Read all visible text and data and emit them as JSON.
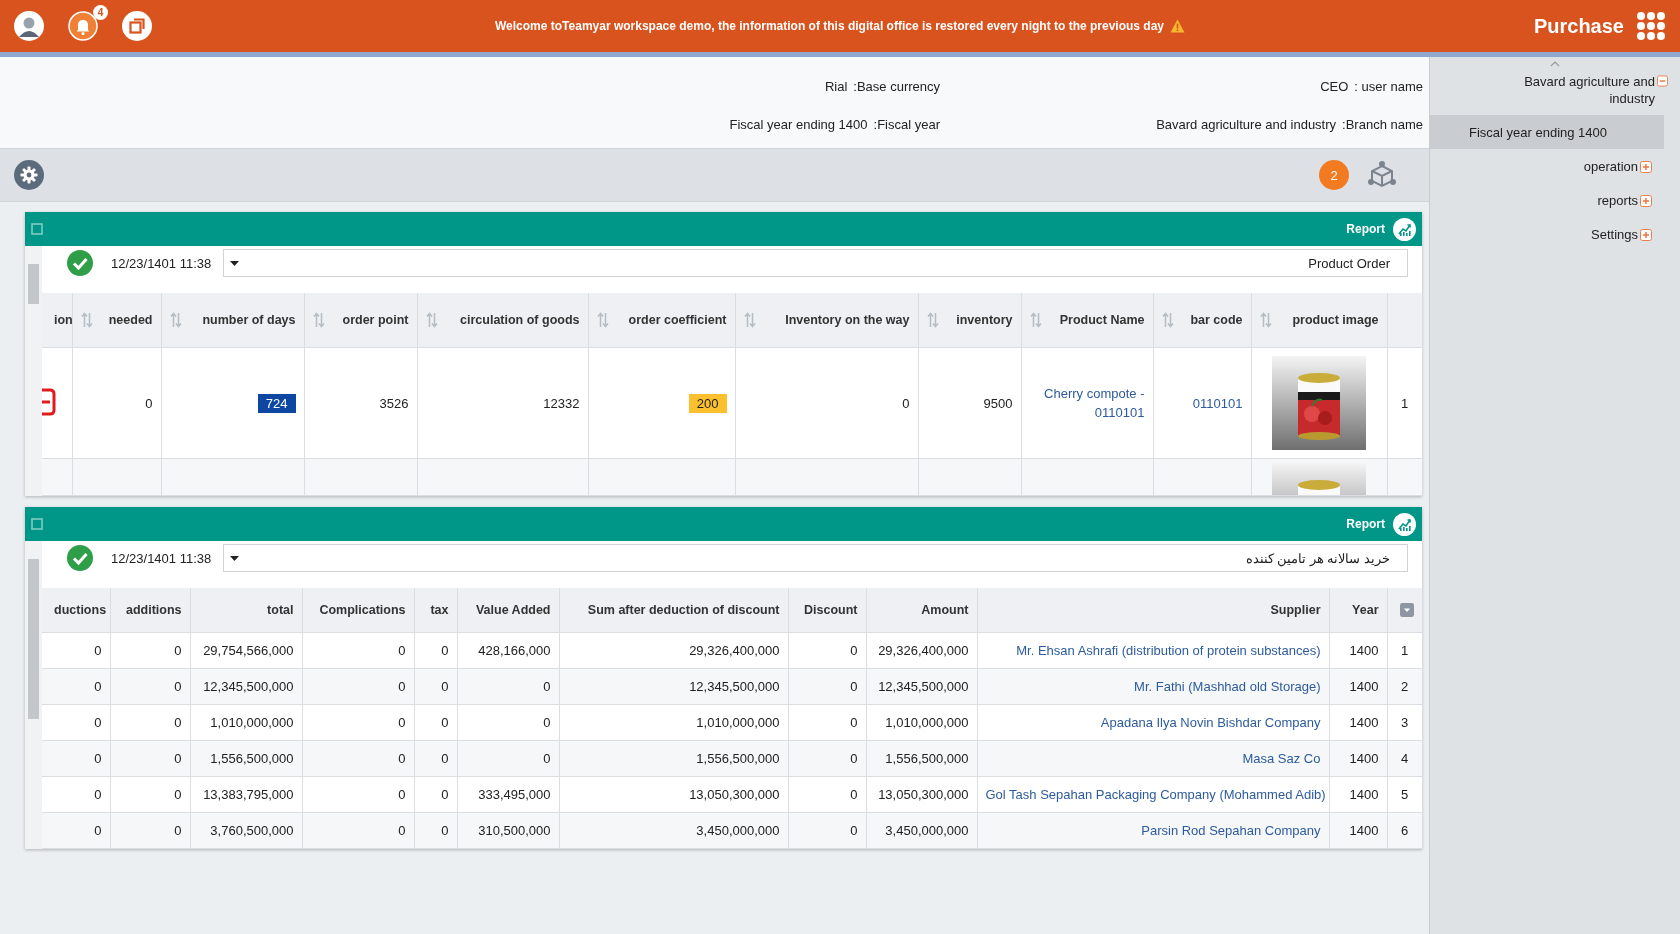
{
  "top_bar": {
    "notification_count": "4",
    "message": "Welcome toTeamyar workspace demo, the information of this digital office is restored every night to the previous day",
    "title": "Purchase"
  },
  "info": [
    {
      "value": "Rial",
      "label": ":Base currency"
    },
    {
      "value": "CEO",
      "label": ": user name"
    },
    {
      "value": "Fiscal year ending 1400",
      "label": ":Fiscal year"
    },
    {
      "value": "Bavard agriculture and industry",
      "label": ":Branch name"
    }
  ],
  "toolbar": {
    "badge": "2"
  },
  "panels": [
    {
      "title": "Report",
      "date": "12/23/1401 11:38",
      "report": "Product Order",
      "index_filter": false,
      "columns": [
        {
          "label": "ion",
          "kind": "mark"
        },
        {
          "label": "needed",
          "kind": "number",
          "sortable": true
        },
        {
          "label": "number of days",
          "kind": "number",
          "sortable": true
        },
        {
          "label": "order point",
          "kind": "number",
          "sortable": true
        },
        {
          "label": "circulation of goods",
          "kind": "number",
          "sortable": true
        },
        {
          "label": "order coefficient",
          "kind": "number",
          "sortable": true
        },
        {
          "label": "Inventory on the way",
          "kind": "number",
          "sortable": true
        },
        {
          "label": "inventory",
          "kind": "number",
          "sortable": true
        },
        {
          "label": "Product Name",
          "kind": "link",
          "sortable": true
        },
        {
          "label": "bar code",
          "kind": "link",
          "sortable": true
        },
        {
          "label": "product image",
          "sortable": true
        },
        {
          "kind": "index",
          "sortable": false
        }
      ],
      "rows": [
        {
          "partial": false,
          "cells": [
            {
              "kind": "remove-mark"
            },
            {
              "text": "0"
            },
            {
              "text": "724",
              "color": "#0d47a1"
            },
            {
              "text": "3526"
            },
            {
              "text": "12332"
            },
            {
              "text": "200",
              "color": "#fbc02d"
            },
            {
              "text": "0"
            },
            {
              "text": "9500"
            },
            {
              "text": "Cherry compote - 0110101"
            },
            {
              "text": "0110101"
            },
            {
              "kind": "picture"
            },
            {
              "text": "1"
            }
          ]
        },
        {
          "partial": true
        }
      ]
    },
    {
      "title": "Report",
      "date": "12/23/1401 11:38",
      "report": "خرید سالانه هر تامین کننده",
      "index_filter": true,
      "columns": [
        {
          "label": "ductions",
          "kind": "number"
        },
        {
          "label": "additions",
          "kind": "number",
          "sortable": false
        },
        {
          "label": "total",
          "kind": "number",
          "sortable": false
        },
        {
          "label": "Complications",
          "kind": "number",
          "sortable": false
        },
        {
          "label": "tax",
          "kind": "number",
          "sortable": false
        },
        {
          "label": "Value Added",
          "kind": "number",
          "sortable": false
        },
        {
          "label": "Sum after deduction of discount",
          "kind": "number",
          "sortable": false
        },
        {
          "label": "Discount",
          "kind": "number",
          "sortable": false
        },
        {
          "label": "Amount",
          "kind": "number",
          "sortable": false
        },
        {
          "label": "Supplier",
          "kind": "link",
          "sortable": false
        },
        {
          "label": "Year",
          "kind": "number",
          "sortable": false
        },
        {
          "kind": "index",
          "sortable": false
        }
      ],
      "rows": [
        {
          "cells": [
            {
              "text": "0"
            },
            {
              "text": "0"
            },
            {
              "text": "29,754,566,000"
            },
            {
              "text": "0"
            },
            {
              "text": "0"
            },
            {
              "text": "428,166,000"
            },
            {
              "text": "29,326,400,000"
            },
            {
              "text": "0"
            },
            {
              "text": "29,326,400,000"
            },
            {
              "text": "Mr. Ehsan Ashrafi (distribution of protein substances)"
            },
            {
              "text": "1400"
            },
            {
              "text": "1"
            }
          ]
        },
        {
          "cells": [
            {
              "text": "0"
            },
            {
              "text": "0"
            },
            {
              "text": "12,345,500,000"
            },
            {
              "text": "0"
            },
            {
              "text": "0"
            },
            {
              "text": "0"
            },
            {
              "text": "12,345,500,000"
            },
            {
              "text": "0"
            },
            {
              "text": "12,345,500,000"
            },
            {
              "text": "Mr. Fathi (Mashhad  old Storage)"
            },
            {
              "text": "1400"
            },
            {
              "text": "2"
            }
          ]
        },
        {
          "cells": [
            {
              "text": "0"
            },
            {
              "text": "0"
            },
            {
              "text": "1,010,000,000"
            },
            {
              "text": "0"
            },
            {
              "text": "0"
            },
            {
              "text": "0"
            },
            {
              "text": "1,010,000,000"
            },
            {
              "text": "0"
            },
            {
              "text": "1,010,000,000"
            },
            {
              "text": "Apadana Ilya Novin Bishdar Company"
            },
            {
              "text": "1400"
            },
            {
              "text": "3"
            }
          ]
        },
        {
          "cells": [
            {
              "text": "0"
            },
            {
              "text": "0"
            },
            {
              "text": "1,556,500,000"
            },
            {
              "text": "0"
            },
            {
              "text": "0"
            },
            {
              "text": "0"
            },
            {
              "text": "1,556,500,000"
            },
            {
              "text": "0"
            },
            {
              "text": "1,556,500,000"
            },
            {
              "text": "Masa Saz Co"
            },
            {
              "text": "1400"
            },
            {
              "text": "4"
            }
          ]
        },
        {
          "cells": [
            {
              "text": "0"
            },
            {
              "text": "0"
            },
            {
              "text": "13,383,795,000"
            },
            {
              "text": "0"
            },
            {
              "text": "0"
            },
            {
              "text": "333,495,000"
            },
            {
              "text": "13,050,300,000"
            },
            {
              "text": "0"
            },
            {
              "text": "13,050,300,000"
            },
            {
              "text": "Gol Tash Sepahan Packaging Company (Mohammed Adib)"
            },
            {
              "text": "1400"
            },
            {
              "text": "5"
            }
          ]
        },
        {
          "cells": [
            {
              "text": "0"
            },
            {
              "text": "0"
            },
            {
              "text": "3,760,500,000"
            },
            {
              "text": "0"
            },
            {
              "text": "0"
            },
            {
              "text": "310,500,000"
            },
            {
              "text": "3,450,000,000"
            },
            {
              "text": "0"
            },
            {
              "text": "3,450,000,000"
            },
            {
              "text": "Parsin Rod Sepahan Company"
            },
            {
              "text": "1400"
            },
            {
              "text": "6"
            }
          ]
        }
      ]
    }
  ],
  "sidebar": {
    "tree": [
      {
        "label": "Bavard agriculture and industry",
        "kind": "node",
        "expanded": true,
        "selected": false,
        "children": [
          {
            "label": "Fiscal year ending 1400",
            "kind": "leaf",
            "selected": true
          },
          {
            "label": "operation",
            "kind": "node",
            "expanded": false,
            "selected": false
          },
          {
            "label": "reports",
            "kind": "node",
            "expanded": false,
            "selected": false
          },
          {
            "label": "Settings",
            "kind": "node",
            "expanded": false,
            "selected": false
          }
        ]
      }
    ]
  }
}
